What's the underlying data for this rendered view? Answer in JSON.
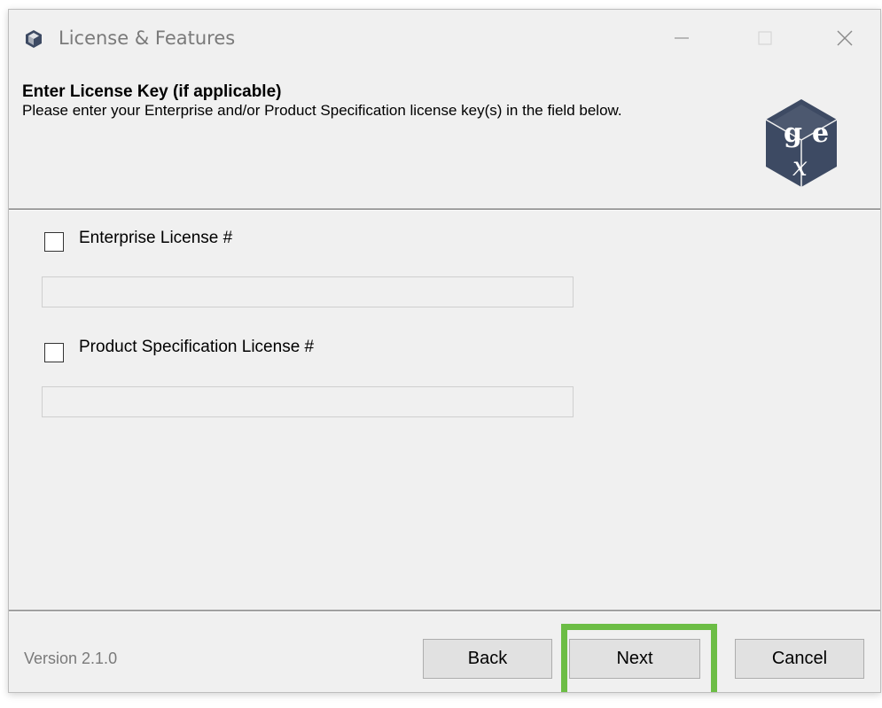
{
  "window": {
    "title": "License & Features",
    "controls": {
      "minimize": "minimize",
      "maximize": "maximize",
      "close": "close"
    }
  },
  "header": {
    "title": "Enter License Key (if applicable)",
    "description": "Please enter your Enterprise and/or Product Specification license key(s) in the field below.",
    "logo_letters": [
      "g",
      "e",
      "x"
    ]
  },
  "form": {
    "enterprise": {
      "label": "Enterprise License #",
      "checked": false,
      "value": ""
    },
    "product_spec": {
      "label": "Product Specification License #",
      "checked": false,
      "value": ""
    }
  },
  "footer": {
    "version": "Version 2.1.0",
    "back_label": "Back",
    "next_label": "Next",
    "cancel_label": "Cancel"
  },
  "colors": {
    "highlight": "#6cbd45",
    "logo": "#3d4a63",
    "window_bg": "#f0f0f0"
  },
  "icons": {
    "app": "app-logo-icon",
    "minimize": "minimize-icon",
    "maximize": "maximize-icon",
    "close": "close-icon"
  }
}
